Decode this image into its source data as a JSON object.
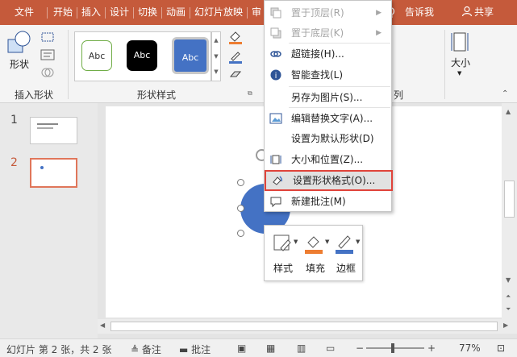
{
  "tabs": [
    "文件",
    "开始",
    "插入",
    "设计",
    "切换",
    "动画",
    "幻灯片放映",
    "审"
  ],
  "tell_me": "告诉我",
  "share": "共享",
  "ribbon": {
    "shape_btn": "形状",
    "insert_shapes_label": "插入形状",
    "shape_styles_label": "形状样式",
    "style_samples": [
      "Abc",
      "Abc",
      "Abc"
    ],
    "arrange_partial": "列",
    "size_label": "大小"
  },
  "slides": [
    {
      "number": "1"
    },
    {
      "number": "2"
    }
  ],
  "context_menu": {
    "items": [
      {
        "label": "置于顶层(R)",
        "disabled": true,
        "submenu": true
      },
      {
        "label": "置于底层(K)",
        "disabled": true,
        "submenu": true
      },
      {
        "label": "超链接(H)...",
        "disabled": false
      },
      {
        "label": "智能查找(L)",
        "disabled": false
      },
      {
        "label": "另存为图片(S)...",
        "disabled": false
      },
      {
        "label": "编辑替换文字(A)...",
        "disabled": false
      },
      {
        "label": "设置为默认形状(D)",
        "disabled": false
      },
      {
        "label": "大小和位置(Z)...",
        "disabled": false
      },
      {
        "label": "设置形状格式(O)...",
        "disabled": false,
        "highlighted": true
      },
      {
        "label": "新建批注(M)",
        "disabled": false
      }
    ]
  },
  "mini_toolbar": {
    "style": "样式",
    "fill": "填充",
    "outline": "边框"
  },
  "status": {
    "slide_info": "幻灯片 第 2 张，共 2 张",
    "notes": "备注",
    "comments": "批注",
    "zoom": "77%"
  },
  "colors": {
    "accent": "#c55a3b",
    "shape_blue": "#4472c4",
    "fill_orange": "#ed7d31",
    "outline_blue": "#4472c4",
    "highlight_red": "#e0433a"
  }
}
